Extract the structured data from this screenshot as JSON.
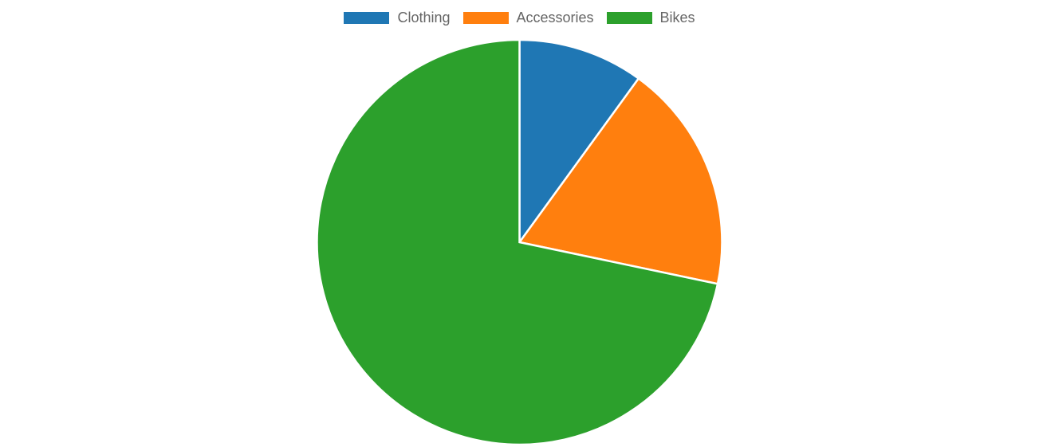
{
  "chart_data": {
    "type": "pie",
    "title": "",
    "legend_position": "top",
    "start_angle": "top",
    "direction": "clockwise",
    "slices": [
      {
        "label": "Clothing",
        "value": 10.0,
        "color": "#1f77b4"
      },
      {
        "label": "Accessories",
        "value": 18.3,
        "color": "#ff7f0e"
      },
      {
        "label": "Bikes",
        "value": 71.7,
        "color": "#2ca02c"
      }
    ]
  }
}
